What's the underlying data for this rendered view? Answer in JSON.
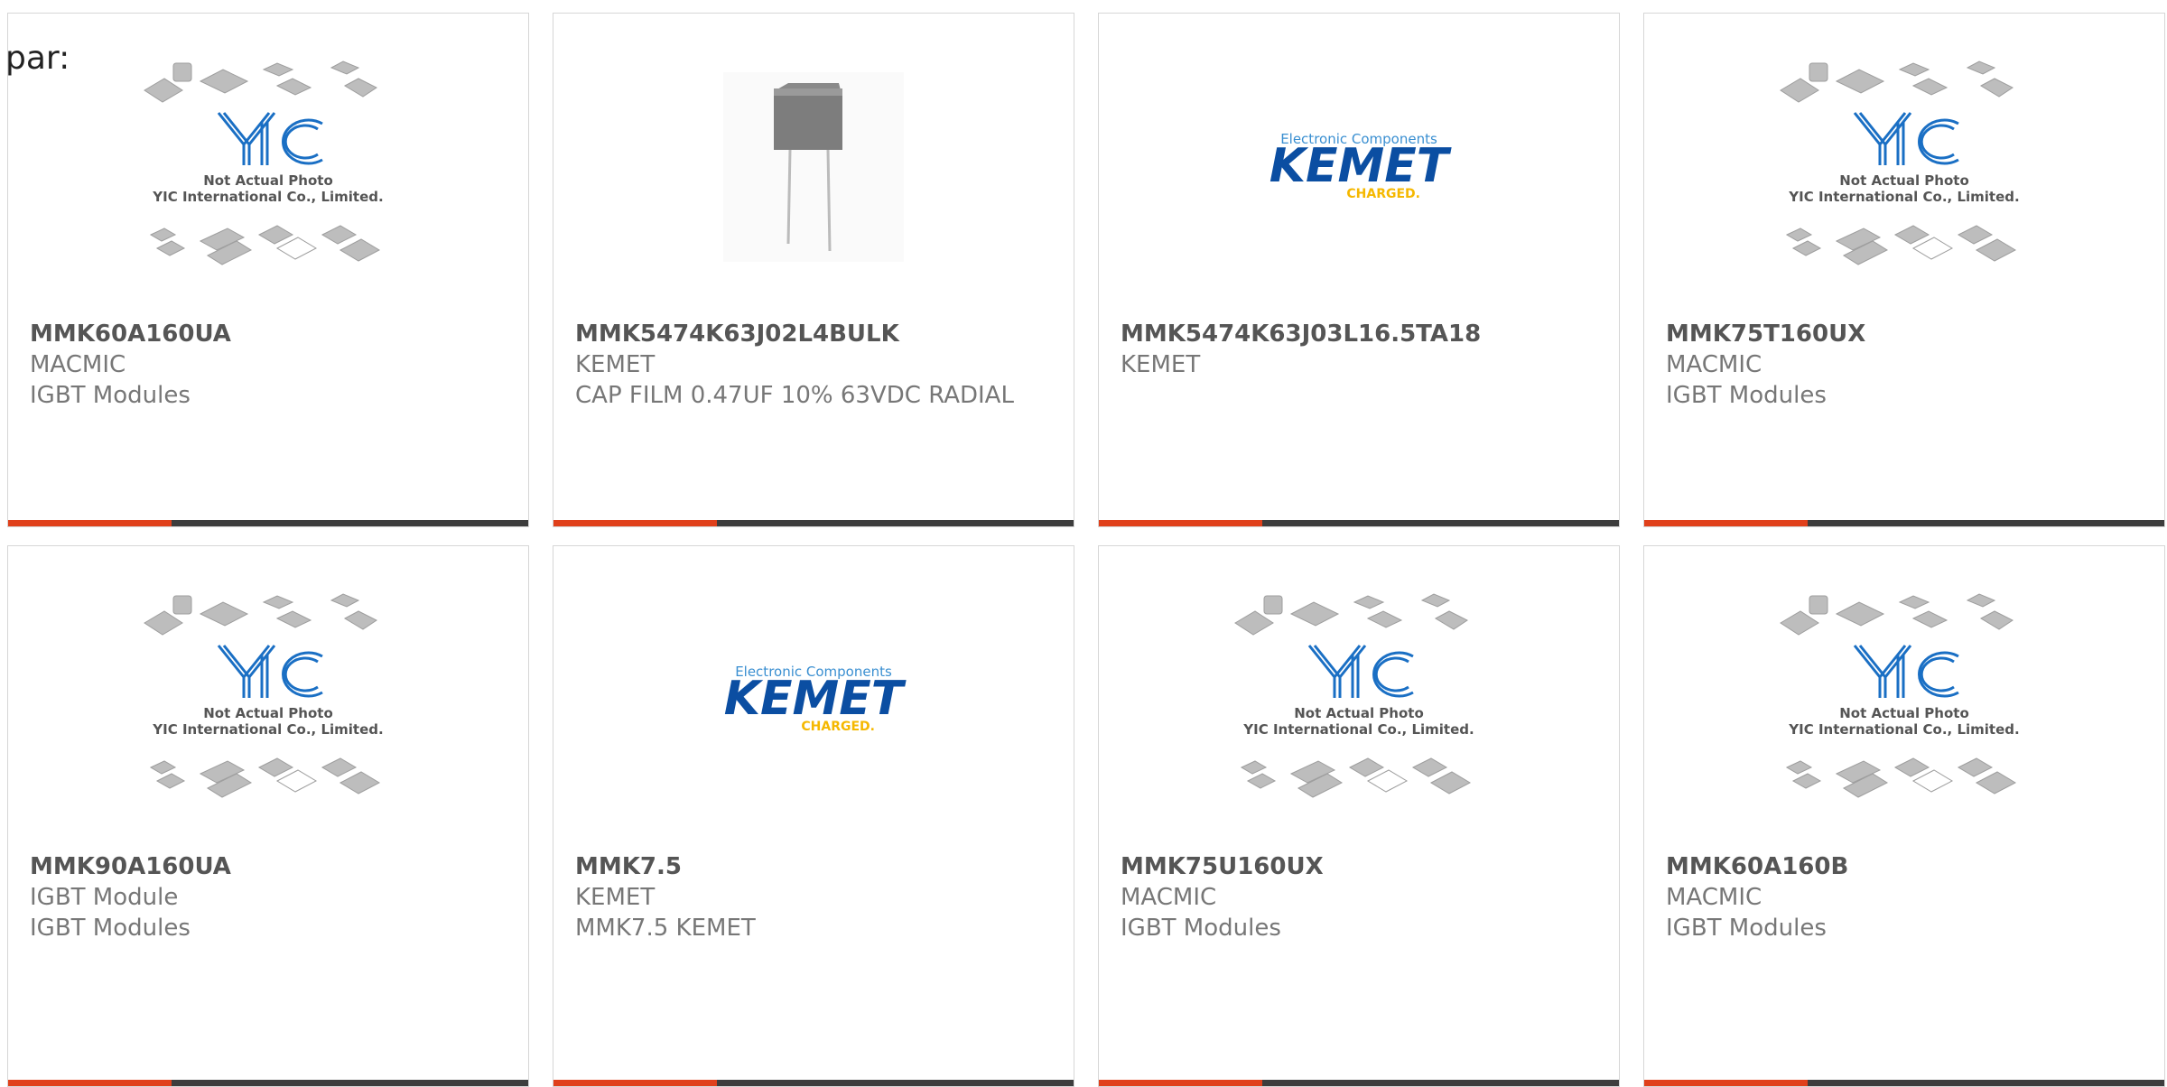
{
  "page_label": "par:",
  "colors": {
    "accent": "#e0401b",
    "bar": "#3d3d3d",
    "kemet_blue": "#0b4ea2",
    "kemet_yellow": "#f5b800",
    "yic_blue": "#1a6fc4"
  },
  "products": [
    {
      "part_number": "MMK60A160UA",
      "manufacturer": "MACMIC",
      "description": "IGBT Modules",
      "image": "yic-placeholder"
    },
    {
      "part_number": "MMK5474K63J02L4BULK",
      "manufacturer": "KEMET",
      "description": "CAP FILM 0.47UF 10% 63VDC RADIAL",
      "image": "film-capacitor-photo"
    },
    {
      "part_number": "MMK5474K63J03L16.5TA18",
      "manufacturer": "KEMET",
      "description": "",
      "image": "kemet-logo"
    },
    {
      "part_number": "MMK75T160UX",
      "manufacturer": "MACMIC",
      "description": "IGBT Modules",
      "image": "yic-placeholder"
    },
    {
      "part_number": "MMK90A160UA",
      "manufacturer": "IGBT Module",
      "description": "IGBT Modules",
      "image": "yic-placeholder"
    },
    {
      "part_number": "MMK7.5",
      "manufacturer": "KEMET",
      "description": "MMK7.5 KEMET",
      "image": "kemet-logo"
    },
    {
      "part_number": "MMK75U160UX",
      "manufacturer": "MACMIC",
      "description": "IGBT Modules",
      "image": "yic-placeholder"
    },
    {
      "part_number": "MMK60A160B",
      "manufacturer": "MACMIC",
      "description": "IGBT Modules",
      "image": "yic-placeholder"
    }
  ],
  "yic_placeholder": {
    "logo_text": "YIC",
    "line1": "Not Actual Photo",
    "line2": "YIC International Co., Limited."
  },
  "kemet_logo": {
    "tagline": "Electronic Components",
    "brand": "KEMET",
    "slogan": "CHARGED."
  }
}
